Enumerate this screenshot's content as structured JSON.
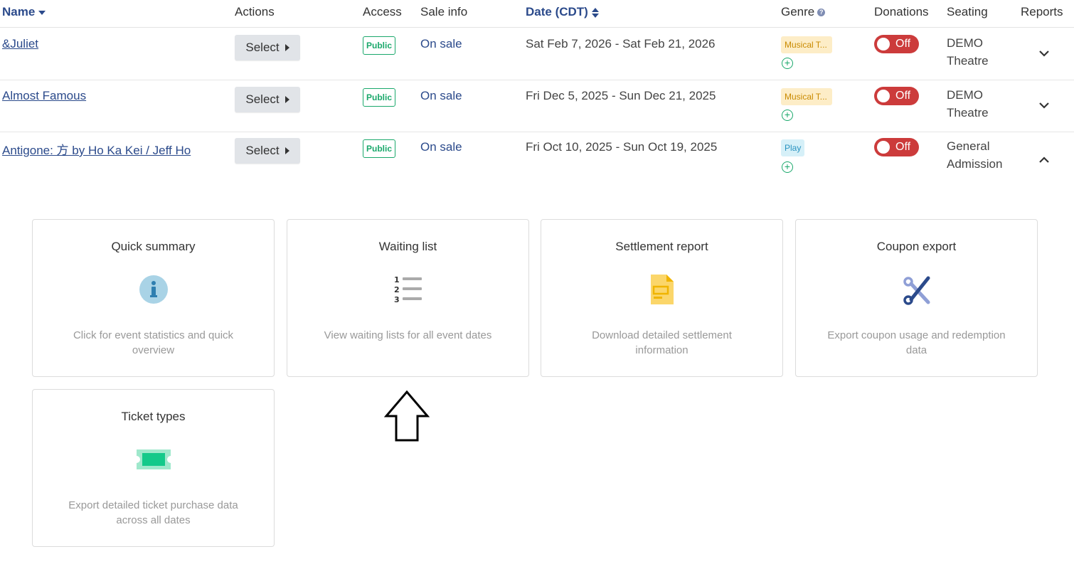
{
  "header": {
    "name": "Name",
    "actions": "Actions",
    "access": "Access",
    "sale_info": "Sale info",
    "date": "Date (CDT)",
    "genre": "Genre",
    "donations": "Donations",
    "seating": "Seating",
    "reports": "Reports"
  },
  "rows": [
    {
      "name": "&Juliet",
      "action": "Select",
      "access": "Public",
      "sale": "On sale",
      "date": "Sat Feb 7, 2026 - Sat Feb 21, 2026",
      "genre": "Musical T...",
      "donations": "Off",
      "seating_line1": "DEMO",
      "seating_line2": "Theatre"
    },
    {
      "name": "Almost Famous",
      "action": "Select",
      "access": "Public",
      "sale": "On sale",
      "date": "Fri Dec 5, 2025 - Sun Dec 21, 2025",
      "genre": "Musical T...",
      "donations": "Off",
      "seating_line1": "DEMO",
      "seating_line2": "Theatre"
    },
    {
      "name": "Antigone: 方 by Ho Ka Kei / Jeff Ho",
      "action": "Select",
      "access": "Public",
      "sale": "On sale",
      "date": "Fri Oct 10, 2025 - Sun Oct 19, 2025",
      "genre": "Play",
      "donations": "Off",
      "seating_line1": "General",
      "seating_line2": "Admission"
    }
  ],
  "reports": [
    {
      "title": "Quick summary",
      "desc": "Click for event statistics and quick overview",
      "icon": "info-icon"
    },
    {
      "title": "Waiting list",
      "desc": "View waiting lists for all event dates",
      "icon": "numbered-list-icon"
    },
    {
      "title": "Settlement report",
      "desc": "Download detailed settlement information",
      "icon": "document-icon"
    },
    {
      "title": "Coupon export",
      "desc": "Export coupon usage and redemption data",
      "icon": "scissors-icon"
    },
    {
      "title": "Ticket types",
      "desc": "Export detailed ticket purchase data across all dates",
      "icon": "ticket-icon"
    }
  ],
  "colors": {
    "link": "#2b4a8b",
    "public": "#1aa86b",
    "toggle_off": "#cc3b3b",
    "musical_bg": "#fdedc7",
    "play_bg": "#d6f0f8"
  }
}
